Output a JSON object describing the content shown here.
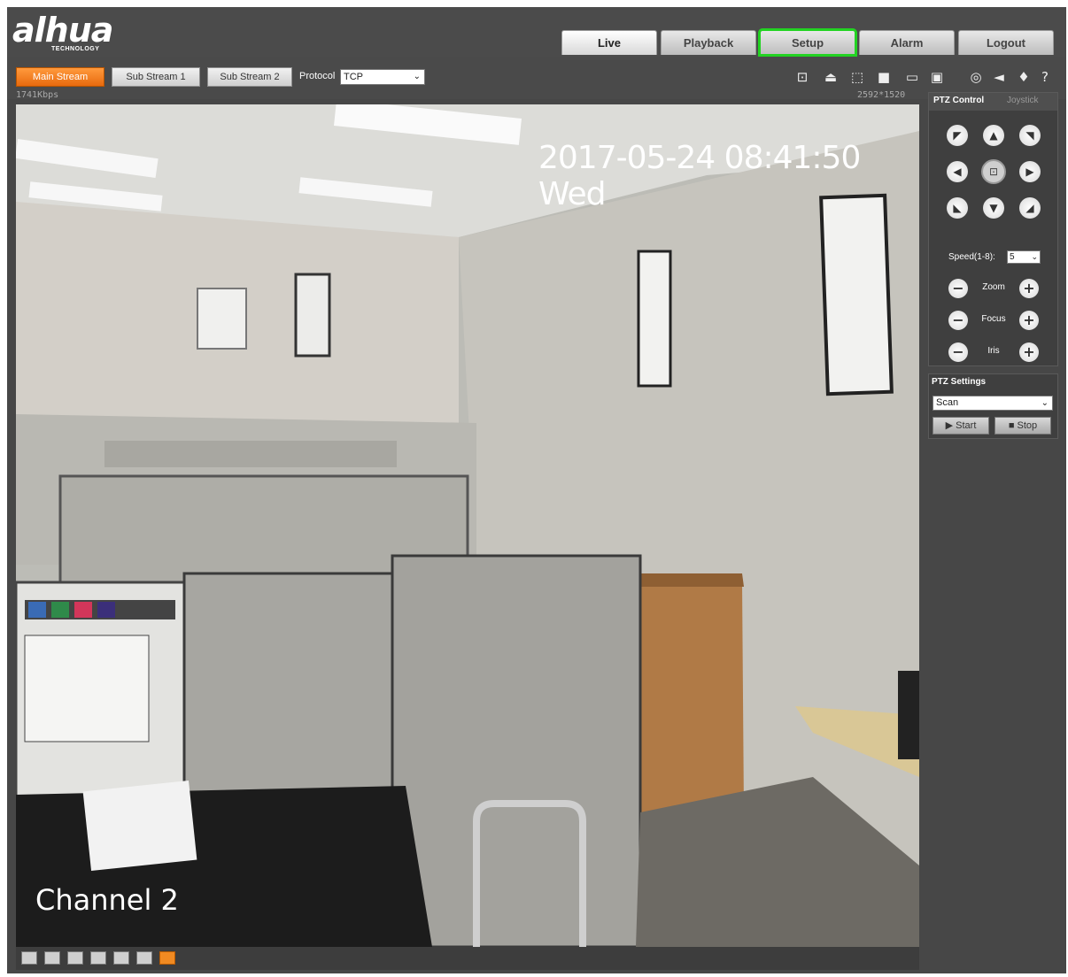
{
  "header": {
    "logo": {
      "brand": "alhua",
      "sub": "TECHNOLOGY"
    },
    "tabs": [
      {
        "label": "Live",
        "active": true
      },
      {
        "label": "Playback",
        "active": false
      },
      {
        "label": "Setup",
        "active": false,
        "highlighted": true
      },
      {
        "label": "Alarm",
        "active": false
      },
      {
        "label": "Logout",
        "active": false
      }
    ]
  },
  "streambar": {
    "streams": [
      "Main Stream",
      "Sub Stream 1",
      "Sub Stream 2"
    ],
    "active_stream": "Main Stream",
    "protocol_label": "Protocol",
    "protocol_value": "TCP",
    "bitrate": "1741Kbps",
    "resolution": "2592*1520",
    "toolbar_icons": [
      "zoom-icon",
      "alarm-light-icon",
      "region-focus-icon",
      "fullscreen-icon",
      "snapshot-icon",
      "record-icon",
      "ptz-preset-icon",
      "audio-icon",
      "microphone-icon",
      "help-icon"
    ]
  },
  "video": {
    "timestamp": "2017-05-24 08:41:50 Wed",
    "channel": "Channel 2"
  },
  "bottombar": {
    "icons": [
      "image-adjust-icon",
      "original-size-icon",
      "fullscreen-icon",
      "aspect-4-3-icon",
      "aspect-16-9-icon",
      "fluency-icon",
      "rules-icon"
    ],
    "active_icon": "rules-icon"
  },
  "ptz": {
    "tabs": [
      "PTZ Control",
      "Joystick"
    ],
    "speed_label": "Speed(1-8):",
    "speed_value": "5",
    "zoom_label": "Zoom",
    "focus_label": "Focus",
    "iris_label": "Iris"
  },
  "ptz_settings": {
    "title": "PTZ Settings",
    "mode": "Scan",
    "start_label": "Start",
    "stop_label": "Stop"
  },
  "colors": {
    "accent": "#f08a22",
    "highlight": "#22d322",
    "panel": "#474747"
  }
}
